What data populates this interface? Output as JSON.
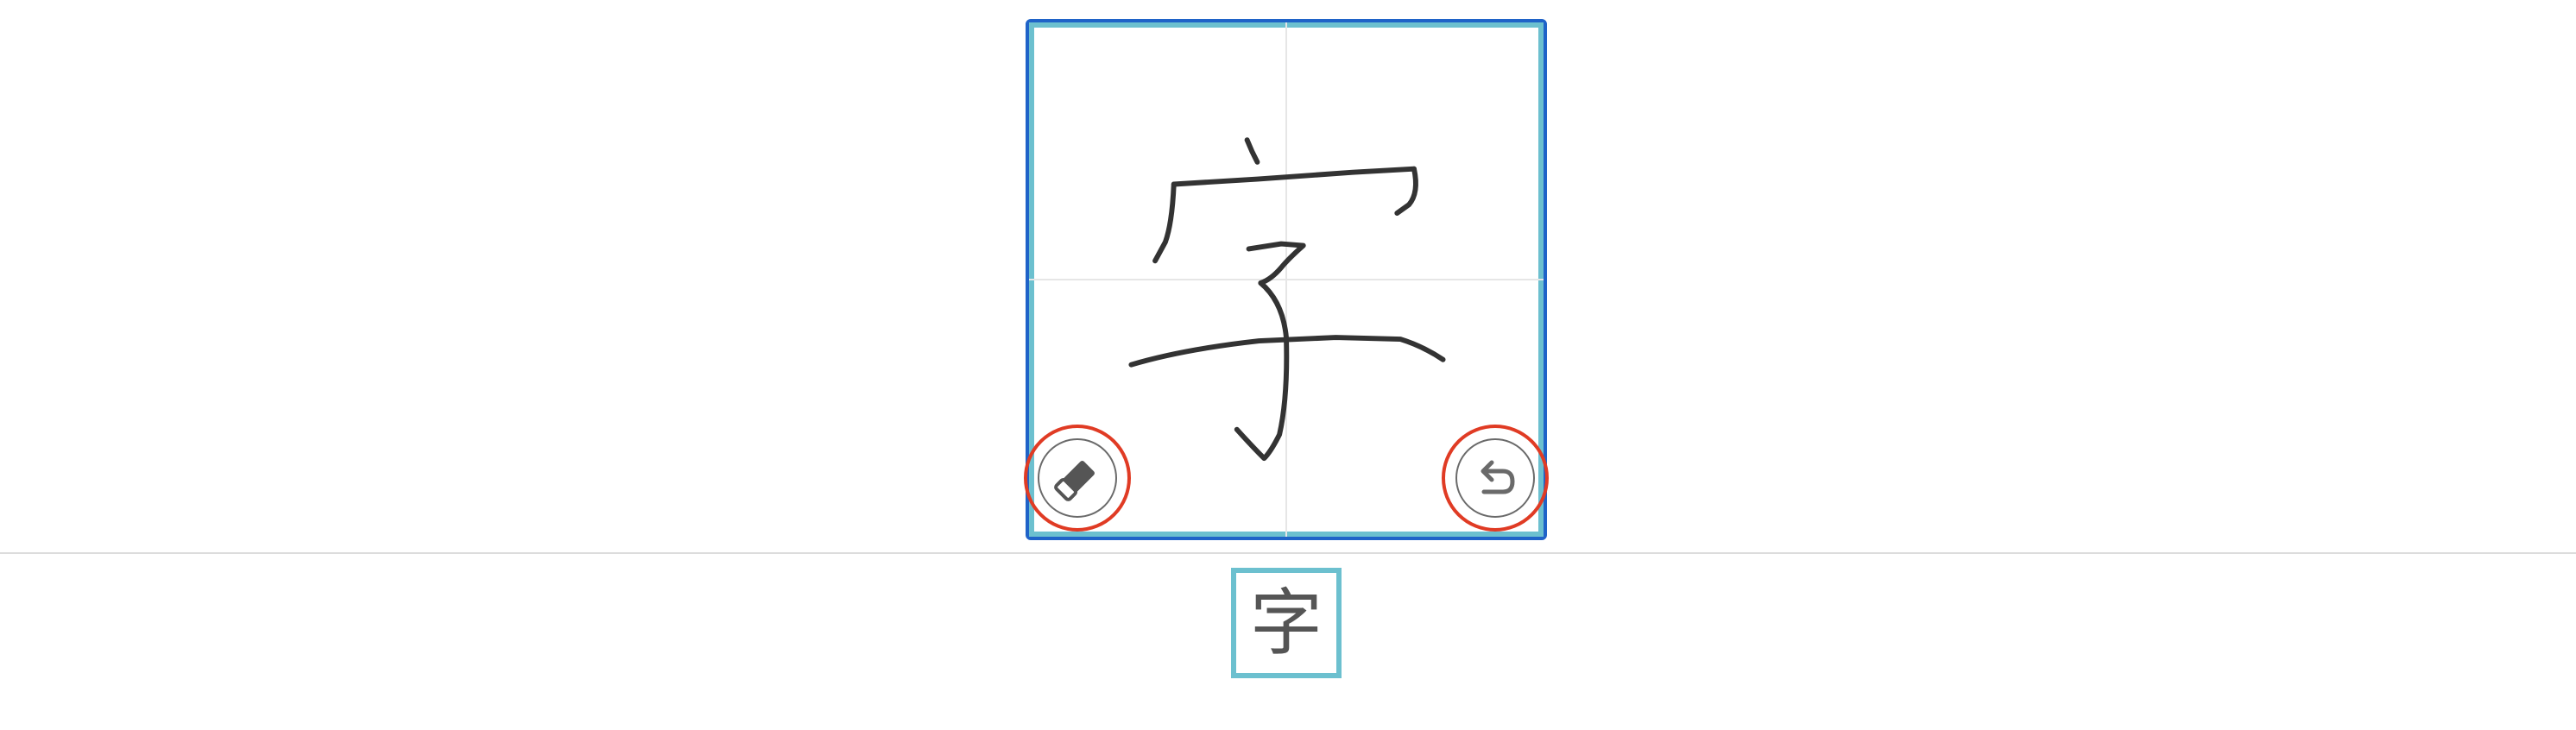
{
  "handwriting_pad": {
    "eraser_icon": "eraser-icon",
    "undo_icon": "undo-icon",
    "frame_color": "#1f63c8",
    "grid_color": "#6cc0cf",
    "highlight_color": "#e03b24"
  },
  "candidates": [
    {
      "character": "字"
    }
  ]
}
